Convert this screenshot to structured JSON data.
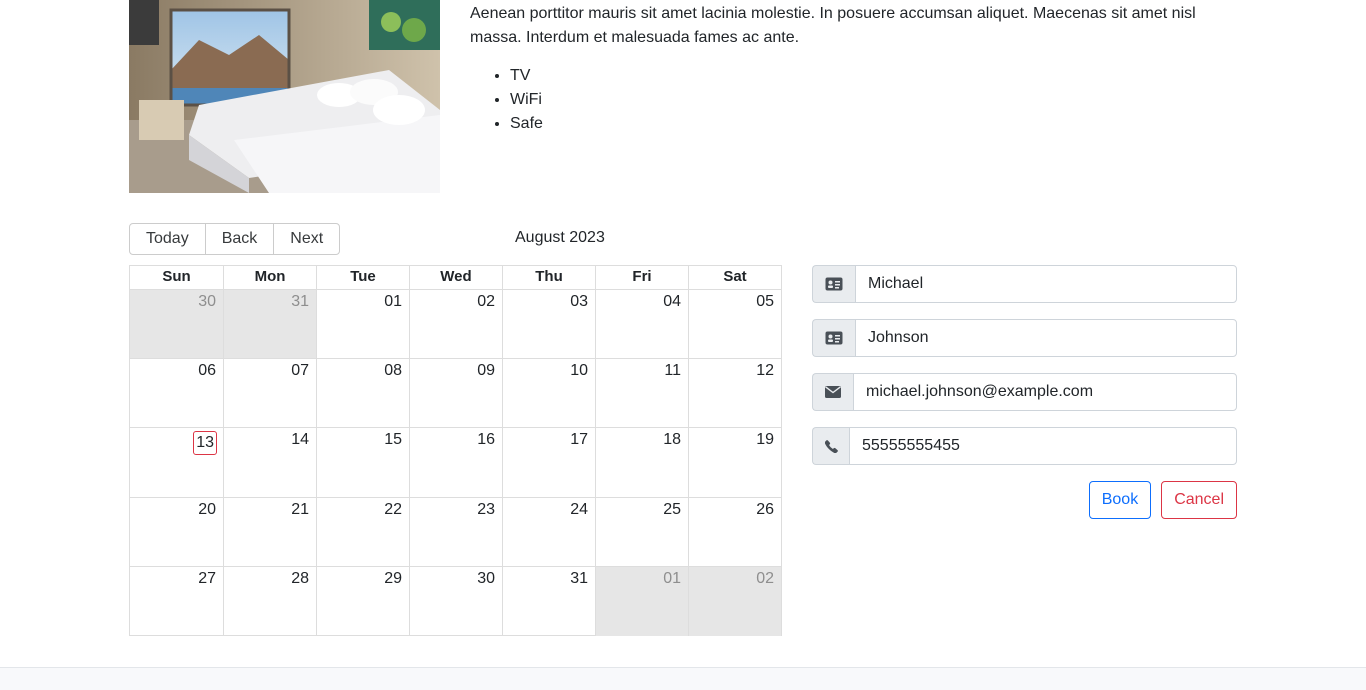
{
  "room": {
    "description": "Aenean porttitor mauris sit amet lacinia molestie. In posuere accumsan aliquet. Maecenas sit amet nisl massa. Interdum et malesuada fames ac ante.",
    "amenities": [
      "TV",
      "WiFi",
      "Safe"
    ]
  },
  "calendar": {
    "toolbar": {
      "today_label": "Today",
      "back_label": "Back",
      "next_label": "Next"
    },
    "month_label": "August 2023",
    "weekdays": [
      "Sun",
      "Mon",
      "Tue",
      "Wed",
      "Thu",
      "Fri",
      "Sat"
    ],
    "days": [
      {
        "label": "30",
        "off": true
      },
      {
        "label": "31",
        "off": true
      },
      {
        "label": "01"
      },
      {
        "label": "02"
      },
      {
        "label": "03"
      },
      {
        "label": "04"
      },
      {
        "label": "05"
      },
      {
        "label": "06"
      },
      {
        "label": "07"
      },
      {
        "label": "08"
      },
      {
        "label": "09"
      },
      {
        "label": "10"
      },
      {
        "label": "11"
      },
      {
        "label": "12"
      },
      {
        "label": "13",
        "today": true
      },
      {
        "label": "14"
      },
      {
        "label": "15"
      },
      {
        "label": "16"
      },
      {
        "label": "17"
      },
      {
        "label": "18"
      },
      {
        "label": "19"
      },
      {
        "label": "20"
      },
      {
        "label": "21"
      },
      {
        "label": "22"
      },
      {
        "label": "23"
      },
      {
        "label": "24"
      },
      {
        "label": "25"
      },
      {
        "label": "26"
      },
      {
        "label": "27"
      },
      {
        "label": "28"
      },
      {
        "label": "29"
      },
      {
        "label": "30"
      },
      {
        "label": "31"
      },
      {
        "label": "01",
        "off": true
      },
      {
        "label": "02",
        "off": true
      }
    ]
  },
  "booking_form": {
    "first_name": {
      "value": "Michael",
      "icon": "id-card-icon"
    },
    "last_name": {
      "value": "Johnson",
      "icon": "id-card-icon"
    },
    "email": {
      "value": "michael.johnson@example.com",
      "icon": "envelope-icon"
    },
    "phone": {
      "value": "55555555455",
      "icon": "phone-icon"
    },
    "book_label": "Book",
    "cancel_label": "Cancel"
  },
  "colors": {
    "primary": "#0d6efd",
    "danger": "#dc3545",
    "off_day_bg": "#e6e6e6"
  }
}
